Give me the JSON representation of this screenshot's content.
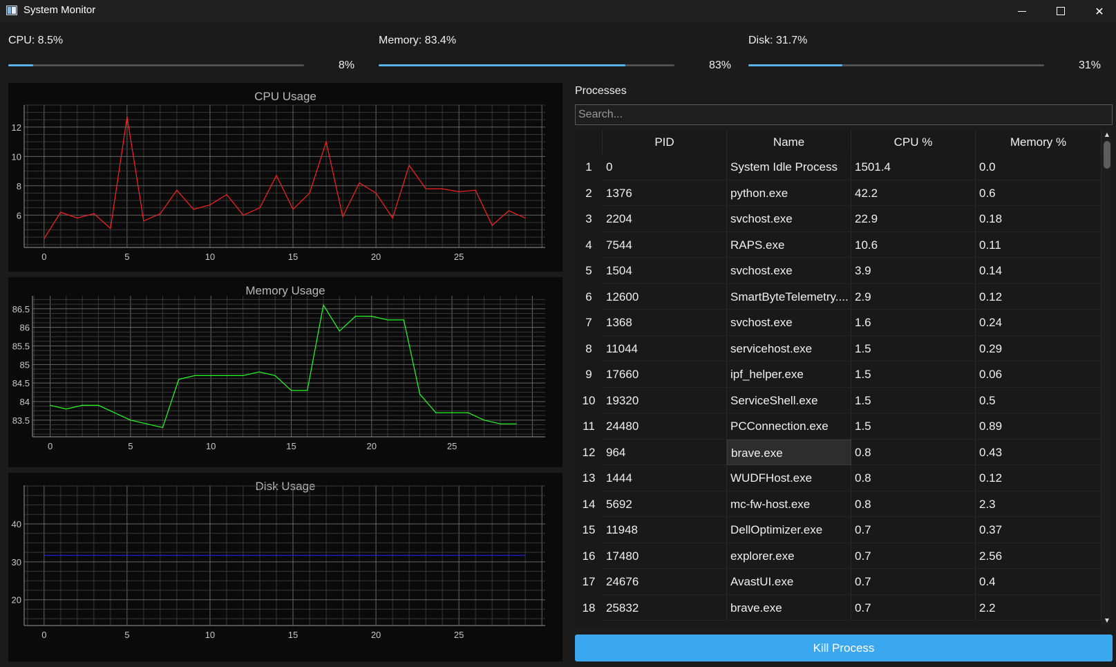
{
  "window": {
    "title": "System Monitor"
  },
  "stats": {
    "cpu": {
      "label": "CPU: 8.5%",
      "percent_text": "8%",
      "fill_fraction": 0.085
    },
    "memory": {
      "label": "Memory: 83.4%",
      "percent_text": "83%",
      "fill_fraction": 0.834
    },
    "disk": {
      "label": "Disk: 31.7%",
      "percent_text": "31%",
      "fill_fraction": 0.317
    }
  },
  "colors": {
    "accent": "#3aa7ee",
    "cpu_line": "#ff2020",
    "memory_line": "#22ff22",
    "disk_line": "#1f1fd0",
    "panel_bg": "#0a0a0a",
    "grid": "#3e3e3e"
  },
  "chart_data": [
    {
      "type": "line",
      "title": "CPU Usage",
      "x": [
        0,
        1,
        2,
        3,
        4,
        5,
        6,
        7,
        8,
        9,
        10,
        11,
        12,
        13,
        14,
        15,
        16,
        17,
        18,
        19,
        20,
        21,
        22,
        23,
        24,
        25,
        26,
        27,
        28,
        29
      ],
      "series": [
        {
          "values": [
            4.4,
            6.2,
            5.8,
            6.1,
            5.1,
            12.7,
            5.6,
            6.1,
            7.7,
            6.4,
            6.7,
            7.4,
            6.0,
            6.5,
            8.7,
            6.4,
            7.5,
            11.0,
            5.9,
            8.2,
            7.5,
            5.8,
            9.4,
            7.8,
            7.8,
            7.6,
            7.7,
            5.3,
            6.3,
            5.8
          ]
        }
      ],
      "xticks": [
        "0",
        "5",
        "10",
        "15",
        "20",
        "25"
      ],
      "yticks": [
        "6",
        "8",
        "10",
        "12"
      ],
      "xlim": [
        -1.2,
        30.2
      ],
      "ylim": [
        3.8,
        13.5
      ],
      "grid": true
    },
    {
      "type": "line",
      "title": "Memory Usage",
      "x": [
        0,
        1,
        2,
        3,
        4,
        5,
        6,
        7,
        8,
        9,
        10,
        11,
        12,
        13,
        14,
        15,
        16,
        17,
        18,
        19,
        20,
        21,
        22,
        23,
        24,
        25,
        26,
        27,
        28,
        29
      ],
      "series": [
        {
          "values": [
            83.9,
            83.8,
            83.9,
            83.9,
            83.7,
            83.5,
            83.4,
            83.3,
            84.6,
            84.7,
            84.7,
            84.7,
            84.7,
            84.8,
            84.7,
            84.3,
            84.3,
            86.6,
            85.9,
            86.3,
            86.3,
            86.2,
            86.2,
            84.2,
            83.7,
            83.7,
            83.7,
            83.5,
            83.4,
            83.4
          ]
        }
      ],
      "xticks": [
        "0",
        "5",
        "10",
        "15",
        "20",
        "25"
      ],
      "yticks": [
        "83.5",
        "84",
        "84.5",
        "85",
        "85.5",
        "86",
        "86.5"
      ],
      "xlim": [
        -1.1,
        30.8
      ],
      "ylim": [
        83.05,
        86.85
      ],
      "grid": true
    },
    {
      "type": "line",
      "title": "Disk Usage",
      "x": [
        0,
        1,
        2,
        3,
        4,
        5,
        6,
        7,
        8,
        9,
        10,
        11,
        12,
        13,
        14,
        15,
        16,
        17,
        18,
        19,
        20,
        21,
        22,
        23,
        24,
        25,
        26,
        27,
        28,
        29
      ],
      "series": [
        {
          "values": [
            31.7,
            31.7,
            31.7,
            31.7,
            31.7,
            31.7,
            31.7,
            31.7,
            31.7,
            31.7,
            31.7,
            31.7,
            31.7,
            31.7,
            31.7,
            31.7,
            31.7,
            31.7,
            31.7,
            31.7,
            31.7,
            31.7,
            31.7,
            31.7,
            31.7,
            31.7,
            31.7,
            31.7,
            31.7,
            31.7
          ]
        }
      ],
      "xticks": [
        "0",
        "5",
        "10",
        "15",
        "20",
        "25"
      ],
      "yticks": [
        "20",
        "30",
        "40"
      ],
      "xlim": [
        -1.2,
        30.2
      ],
      "ylim": [
        13.2,
        50.2
      ],
      "grid": true
    }
  ],
  "processes": {
    "label": "Processes",
    "search_placeholder": "Search...",
    "columns": [
      "PID",
      "Name",
      "CPU %",
      "Memory %"
    ],
    "selected_row": 12,
    "rows": [
      {
        "num": "1",
        "pid": "0",
        "name": "System Idle Process",
        "cpu": "1501.4",
        "mem": "0.0"
      },
      {
        "num": "2",
        "pid": "1376",
        "name": "python.exe",
        "cpu": "42.2",
        "mem": "0.6"
      },
      {
        "num": "3",
        "pid": "2204",
        "name": "svchost.exe",
        "cpu": "22.9",
        "mem": "0.18"
      },
      {
        "num": "4",
        "pid": "7544",
        "name": "RAPS.exe",
        "cpu": "10.6",
        "mem": "0.11"
      },
      {
        "num": "5",
        "pid": "1504",
        "name": "svchost.exe",
        "cpu": "3.9",
        "mem": "0.14"
      },
      {
        "num": "6",
        "pid": "12600",
        "name": "SmartByteTelemetry....",
        "cpu": "2.9",
        "mem": "0.12"
      },
      {
        "num": "7",
        "pid": "1368",
        "name": "svchost.exe",
        "cpu": "1.6",
        "mem": "0.24"
      },
      {
        "num": "8",
        "pid": "11044",
        "name": "servicehost.exe",
        "cpu": "1.5",
        "mem": "0.29"
      },
      {
        "num": "9",
        "pid": "17660",
        "name": "ipf_helper.exe",
        "cpu": "1.5",
        "mem": "0.06"
      },
      {
        "num": "10",
        "pid": "19320",
        "name": "ServiceShell.exe",
        "cpu": "1.5",
        "mem": "0.5"
      },
      {
        "num": "11",
        "pid": "24480",
        "name": "PCConnection.exe",
        "cpu": "1.5",
        "mem": "0.89"
      },
      {
        "num": "12",
        "pid": "964",
        "name": "brave.exe",
        "cpu": "0.8",
        "mem": "0.43"
      },
      {
        "num": "13",
        "pid": "1444",
        "name": "WUDFHost.exe",
        "cpu": "0.8",
        "mem": "0.12"
      },
      {
        "num": "14",
        "pid": "5692",
        "name": "mc-fw-host.exe",
        "cpu": "0.8",
        "mem": "2.3"
      },
      {
        "num": "15",
        "pid": "11948",
        "name": "DellOptimizer.exe",
        "cpu": "0.7",
        "mem": "0.37"
      },
      {
        "num": "16",
        "pid": "17480",
        "name": "explorer.exe",
        "cpu": "0.7",
        "mem": "2.56"
      },
      {
        "num": "17",
        "pid": "24676",
        "name": "AvastUI.exe",
        "cpu": "0.7",
        "mem": "0.4"
      },
      {
        "num": "18",
        "pid": "25832",
        "name": "brave.exe",
        "cpu": "0.7",
        "mem": "2.2"
      }
    ]
  },
  "kill_button": {
    "label": "Kill Process"
  }
}
